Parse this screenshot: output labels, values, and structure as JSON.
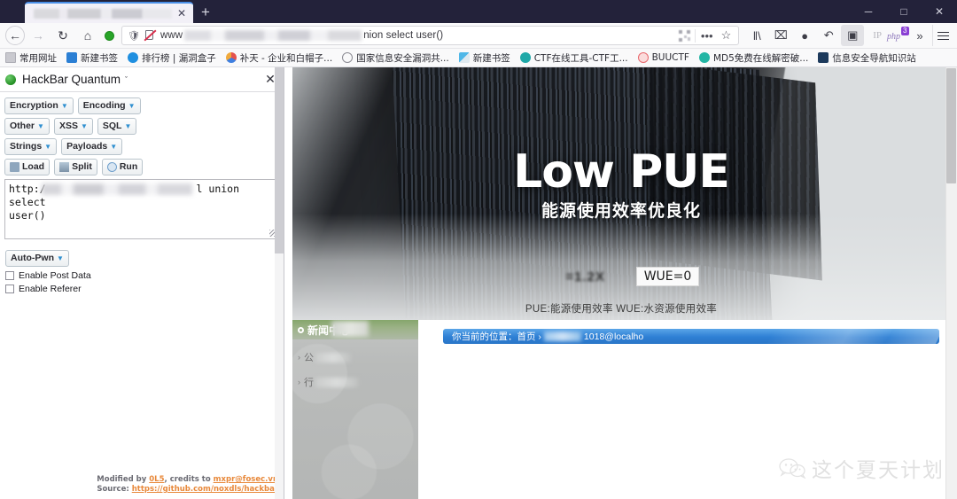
{
  "window": {
    "controls": {
      "minimize": "─",
      "maximize": "□",
      "close": "✕"
    },
    "tab": {
      "close_label": "✕",
      "title_redacted": ""
    },
    "new_tab_label": "+"
  },
  "navbar": {
    "back": "←",
    "forward": "→",
    "reload": "↻",
    "home": "⌂",
    "status_dot": "connected-indicator",
    "url_prefix": "www",
    "url_suffix": "nion select user()",
    "qr_icon": "qr-code-icon",
    "page_actions": "•••",
    "bookmark_star": "☆",
    "icons": [
      {
        "name": "library-icon",
        "glyph": "‖\\"
      },
      {
        "name": "screenshot-icon",
        "glyph": "⌧"
      },
      {
        "name": "pocket-icon",
        "glyph": "●"
      },
      {
        "name": "undo-icon",
        "glyph": "↶"
      },
      {
        "name": "reader-view-icon",
        "glyph": "▣"
      }
    ],
    "ip_label": "IP",
    "php_label": "php",
    "php_badge_count": "3",
    "overflow": "»",
    "menu": "menu-icon"
  },
  "bookmarks": [
    {
      "label": "常用网址",
      "icon": "folder-icon",
      "color": "#c9c9cf"
    },
    {
      "label": "新建书签",
      "icon": "bookmark-blue-icon",
      "color": "#2b7fd4"
    },
    {
      "label": "排行榜 | 漏洞盒子",
      "icon": "circle-blue-icon",
      "color": "#1f8fe0"
    },
    {
      "label": "补天 - 企业和白帽子...",
      "icon": "butian-icon",
      "color": "#e5524d"
    },
    {
      "label": "国家信息安全漏洞共...",
      "icon": "globe-icon",
      "color": "#8b8b93"
    },
    {
      "label": "新建书签",
      "icon": "bookmark-teal-icon",
      "color": "#2f9fd0"
    },
    {
      "label": "CTF在线工具-CTF工...",
      "icon": "ctf-icon",
      "color": "#1fa8a8"
    },
    {
      "label": "BUUCTF",
      "icon": "buuctf-icon",
      "color": "#e8686d"
    },
    {
      "label": "MD5免费在线解密破...",
      "icon": "md5-icon",
      "color": "#23b5a4"
    },
    {
      "label": "信息安全导航知识站",
      "icon": "navsite-icon",
      "color": "#1d3a5c"
    }
  ],
  "hackbar": {
    "title": "HackBar Quantum",
    "title_caret": "ˇ",
    "close": "✕",
    "menu_rows": [
      [
        {
          "label": "Encryption",
          "caret": "▼"
        },
        {
          "label": "Encoding",
          "caret": "▼"
        }
      ],
      [
        {
          "label": "Other",
          "caret": "▼"
        },
        {
          "label": "XSS",
          "caret": "▼"
        },
        {
          "label": "SQL",
          "caret": "▼"
        }
      ],
      [
        {
          "label": "Strings",
          "caret": "▼"
        },
        {
          "label": "Payloads",
          "caret": "▼"
        }
      ]
    ],
    "actions": [
      {
        "label": "Load",
        "icon": "load-icon"
      },
      {
        "label": "Split",
        "icon": "split-icon"
      },
      {
        "label": "Run",
        "icon": "run-icon"
      }
    ],
    "request_prefix": "http:/",
    "request_suffix": "l union select",
    "request_line2": "user()",
    "auto_pwn": {
      "label": "Auto-Pwn",
      "caret": "▼"
    },
    "checkboxes": [
      {
        "label": "Enable Post Data",
        "checked": false
      },
      {
        "label": "Enable Referer",
        "checked": false
      }
    ],
    "footer": {
      "line1_pre": "Modified by ",
      "line1_link": "0L5",
      "line1_mid": ", credits to ",
      "line1_link2": "mxpr@fosec.vn",
      "line2_pre": "Source: ",
      "line2_link": "https://github.com/noxdls/hackbar"
    }
  },
  "page": {
    "hero": {
      "title": "Low PUE",
      "subtitle": "能源使用效率优良化",
      "metric_blurred": "=1.2X",
      "metric_box": "WUE=0",
      "note": "PUE:能源使用效率  WUE:水资源使用效率"
    },
    "sidenav": {
      "heading": "新闻中心",
      "heading_bullet": "●",
      "items": [
        {
          "arrow": "›",
          "label": "公"
        },
        {
          "arrow": "›",
          "label": "行"
        }
      ]
    },
    "breadcrumb": {
      "prefix": "你当前的位置：首页 ›",
      "suffix": "1018@localho"
    },
    "watermark": {
      "icon": "wechat-icon",
      "text": "这个夏天计划"
    }
  },
  "colors": {
    "titlebar": "#23223a",
    "toolbar": "#f9f9fa",
    "tab_accent": "#4a8fe8",
    "breadcrumb_blue": "#2e7fd4",
    "hackbar_link": "#e8883a",
    "status_green": "#28a428"
  }
}
